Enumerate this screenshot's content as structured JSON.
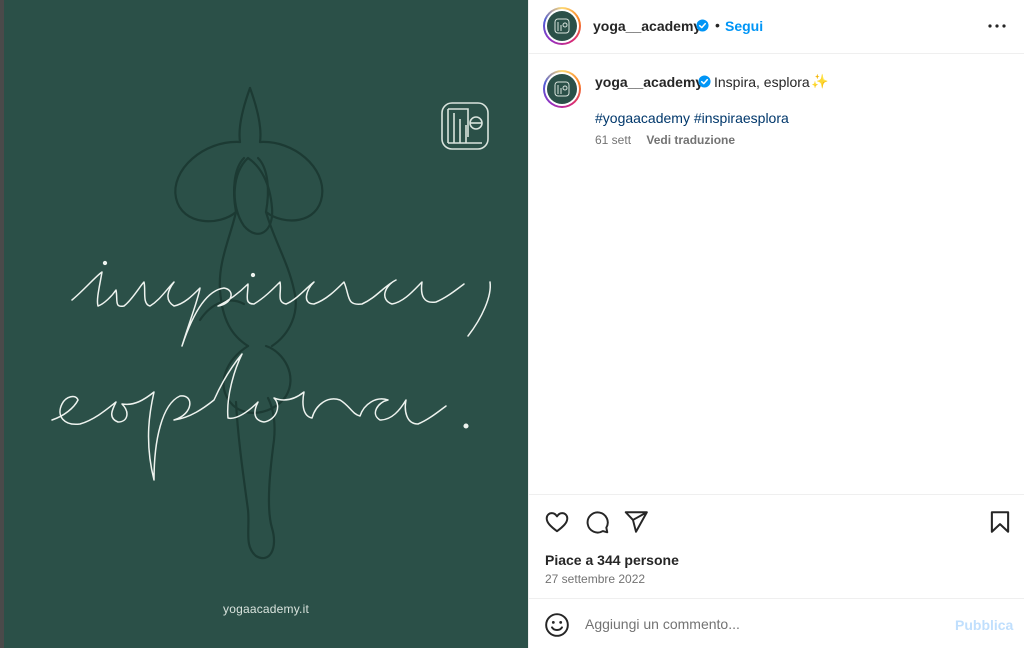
{
  "post": {
    "username": "yoga__academy",
    "follow_label": "Segui",
    "separator": "•",
    "caption_text": "Inspira, esplora",
    "caption_emoji": "✨",
    "hashtags": [
      "#yogaacademy",
      "#inspiraesplora"
    ],
    "age": "61 sett",
    "translate_label": "Vedi traduzione",
    "likes_text": "Piace a 344 persone",
    "date": "27 settembre 2022"
  },
  "image": {
    "script_line1": "inspira,",
    "script_line2": "esplora.",
    "website": "yogaacademy.it",
    "background_color": "#2b5048"
  },
  "comment_box": {
    "placeholder": "Aggiungi un commento...",
    "post_label": "Pubblica"
  },
  "icons": {
    "verified": "verified-badge-icon",
    "more": "more-options-icon",
    "like": "heart-icon",
    "comment": "comment-icon",
    "share": "share-icon",
    "save": "bookmark-icon",
    "emoji": "emoji-icon"
  },
  "colors": {
    "accent": "#0095f6",
    "hashtag": "#00376b",
    "muted": "#737373"
  }
}
